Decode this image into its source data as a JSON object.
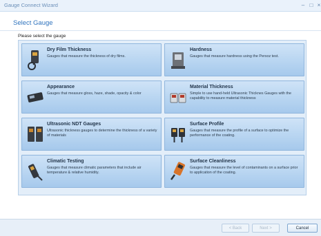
{
  "window": {
    "title": "Gauge Connect Wizard",
    "min": "–",
    "max": "□",
    "close": "×"
  },
  "header": {
    "title": "Select Gauge"
  },
  "prompt": "Please select the gauge",
  "tiles": [
    {
      "title": "Dry Film Thickness",
      "desc": "Gauges that measure the thickness of dry films.",
      "icon": "dry-film-gauge-icon"
    },
    {
      "title": "Hardness",
      "desc": "Gauges that measure hardness using the Persoz test.",
      "icon": "hardness-gauge-icon"
    },
    {
      "title": "Appearance",
      "desc": "Gauges that measure gloss, haze, shade, opacity & color",
      "icon": "gloss-meter-icon"
    },
    {
      "title": "Material Thickness",
      "desc": "Simple to use hand-held Ultrasonic Thicknes Gauges with the capability to measure material thickness",
      "icon": "ultrasonic-probe-icon"
    },
    {
      "title": "Ultrasonic NDT Gauges",
      "desc": "Ultrasonic thickness gauges to determine the thickness of a variety of materials",
      "icon": "ndt-gauge-icon"
    },
    {
      "title": "Surface Profile",
      "desc": "Gauges that measure the profile of a surface to optimize the performance of the coating.",
      "icon": "surface-profile-gauge-icon"
    },
    {
      "title": "Climatic Testing",
      "desc": "Gauges that measure climatic parameters that include air temperature & relative humidity.",
      "icon": "climate-probe-icon"
    },
    {
      "title": "Surface Cleanliness",
      "desc": "Gauges that measure the level of contaminants on a surface prior to application of the coating.",
      "icon": "cleanliness-gauge-icon"
    }
  ],
  "buttons": {
    "back": "< Back",
    "next": "Next >",
    "cancel": "Cancel"
  }
}
